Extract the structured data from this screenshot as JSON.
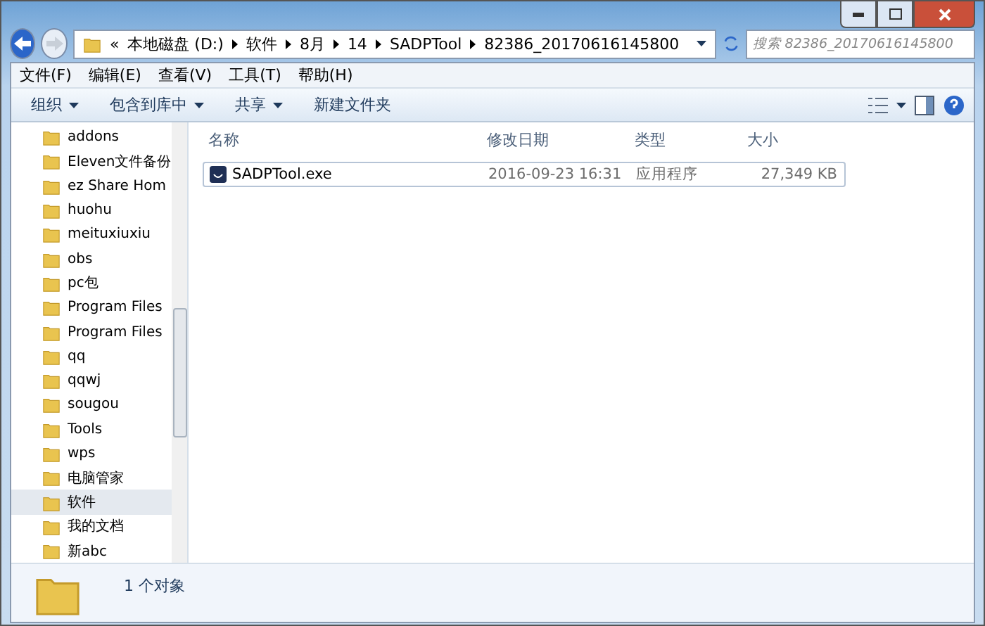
{
  "address": {
    "overflow": "«",
    "crumbs": [
      "本地磁盘 (D:)",
      "软件",
      "8月",
      "14",
      "SADPTool",
      "82386_20170616145800"
    ]
  },
  "search": {
    "placeholder": "搜索 82386_20170616145800"
  },
  "menu": [
    "文件(F)",
    "编辑(E)",
    "查看(V)",
    "工具(T)",
    "帮助(H)"
  ],
  "toolbar": [
    {
      "label": "组织",
      "dropdown": true
    },
    {
      "label": "包含到库中",
      "dropdown": true
    },
    {
      "label": "共享",
      "dropdown": true
    },
    {
      "label": "新建文件夹",
      "dropdown": false
    }
  ],
  "tree": [
    {
      "label": "addons",
      "selected": false
    },
    {
      "label": "Eleven文件备份",
      "selected": false
    },
    {
      "label": "ez Share Hom",
      "selected": false
    },
    {
      "label": "huohu",
      "selected": false
    },
    {
      "label": "meituxiuxiu",
      "selected": false
    },
    {
      "label": "obs",
      "selected": false
    },
    {
      "label": "pc包",
      "selected": false
    },
    {
      "label": "Program Files",
      "selected": false
    },
    {
      "label": "Program Files",
      "selected": false
    },
    {
      "label": "qq",
      "selected": false
    },
    {
      "label": "qqwj",
      "selected": false
    },
    {
      "label": "sougou",
      "selected": false
    },
    {
      "label": "Tools",
      "selected": false
    },
    {
      "label": "wps",
      "selected": false
    },
    {
      "label": "电脑管家",
      "selected": false
    },
    {
      "label": "软件",
      "selected": true
    },
    {
      "label": "我的文档",
      "selected": false
    },
    {
      "label": "新abc",
      "selected": false
    }
  ],
  "table": {
    "columns": [
      "名称",
      "修改日期",
      "类型",
      "大小"
    ],
    "rows": [
      {
        "name": "SADPTool.exe",
        "modified": "2016-09-23 16:31",
        "type": "应用程序",
        "size": "27,349 KB",
        "selected": true
      }
    ]
  },
  "status_bar": {
    "text": "1 个对象"
  }
}
